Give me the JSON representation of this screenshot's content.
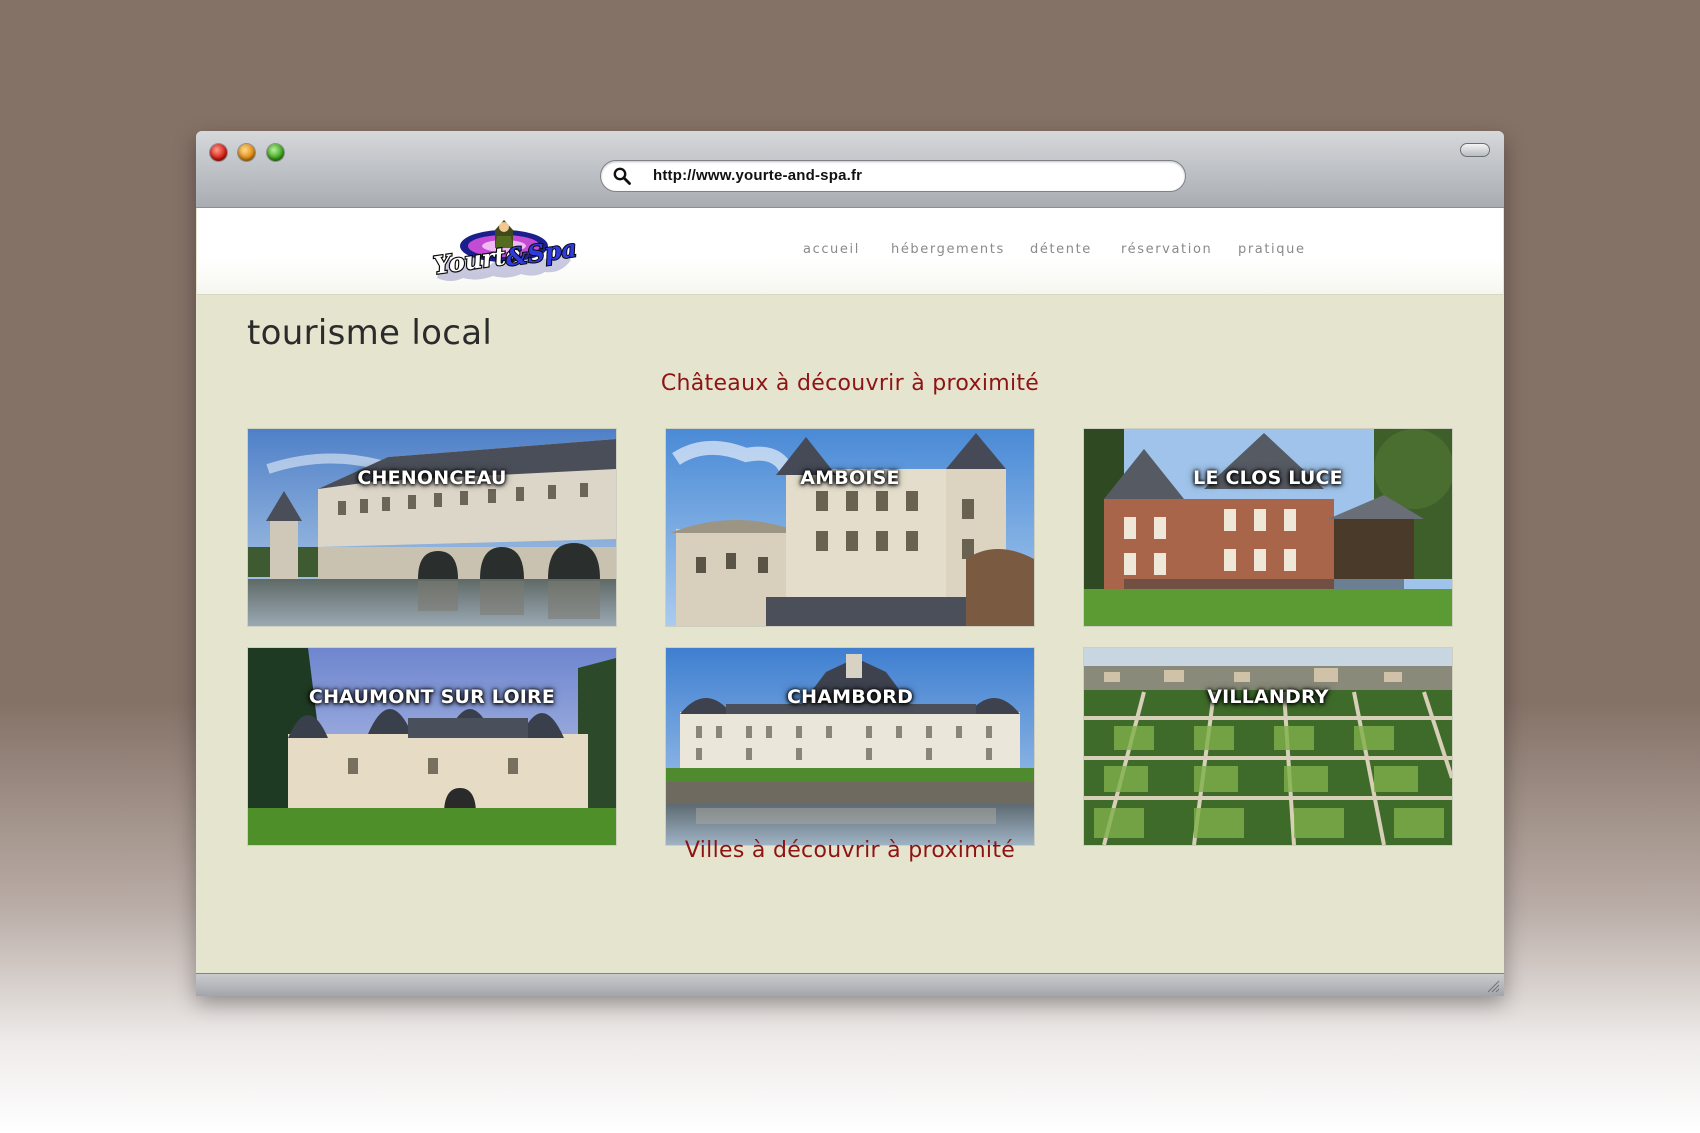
{
  "browser": {
    "url": "http://www.yourte-and-spa.fr"
  },
  "site": {
    "logo_text": "Yourte&Spa",
    "nav": [
      {
        "label": "accueil"
      },
      {
        "label": "hébergements"
      },
      {
        "label": "détente"
      },
      {
        "label": "réservation"
      },
      {
        "label": "pratique"
      }
    ]
  },
  "page": {
    "title": "tourisme local",
    "sections": [
      {
        "heading": "Châteaux à découvrir à proximité",
        "cards": [
          {
            "label": "CHENONCEAU"
          },
          {
            "label": "AMBOISE"
          },
          {
            "label": "LE CLOS LUCE"
          },
          {
            "label": "CHAUMONT SUR LOIRE"
          },
          {
            "label": "CHAMBORD"
          },
          {
            "label": "VILLANDRY"
          }
        ]
      },
      {
        "heading": "Villes à découvrir à proximité"
      }
    ]
  },
  "colors": {
    "heading_accent": "#8e1414",
    "content_background": "#e5e4cf",
    "nav_text": "#8a8a8a"
  }
}
